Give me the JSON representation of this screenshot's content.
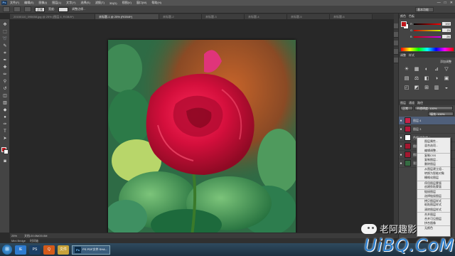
{
  "menubar": {
    "logo": "Ps",
    "items": [
      "文件(F)",
      "编辑(E)",
      "图像(I)",
      "图层(L)",
      "文字(Y)",
      "选择(S)",
      "滤镜(T)",
      "3D(D)",
      "视图(V)",
      "窗口(W)",
      "帮助(H)"
    ],
    "controls": [
      "—",
      "□",
      "✕"
    ]
  },
  "optionsbar": {
    "mode_label": "正常",
    "width_label": "宽度:",
    "adjust_label": "调整边缘...",
    "workspace": "基本功能"
  },
  "tabs": [
    {
      "label": "20150110_095658.jpg @ 25% (图层 4, RGB/8*)",
      "active": false
    },
    {
      "label": "未标题-1 @ 25% (RGB/8*)",
      "active": true
    },
    {
      "label": "未标题-2",
      "active": false
    },
    {
      "label": "未标题-3",
      "active": false
    },
    {
      "label": "未标题-4",
      "active": false
    },
    {
      "label": "未标题-5",
      "active": false
    },
    {
      "label": "未标题-6",
      "active": false
    }
  ],
  "statusbar": {
    "zoom": "25%",
    "doc_info": "文档:20.0M/20.0M"
  },
  "minibridge": [
    "Mini Bridge",
    "时间轴"
  ],
  "panels": {
    "tabs": [
      "颜色",
      "色板"
    ],
    "sliders": [
      {
        "label": "R",
        "value": "192"
      },
      {
        "label": "G",
        "value": "21"
      },
      {
        "label": "B",
        "value": "26"
      }
    ],
    "adjust_tabs": [
      "调整",
      "样式"
    ],
    "adjust_title": "添加调整",
    "adj_icons": [
      "☀",
      "▦",
      "◐",
      "⊿",
      "▽",
      "▤",
      "⚖",
      "◧",
      "◑",
      "▣",
      "◰",
      "◩",
      "⊞",
      "▥",
      "◒"
    ],
    "layers_tabs": [
      "图层",
      "通道",
      "路径"
    ],
    "blend_mode": "正常",
    "opacity": "不透明度: 100%",
    "fill": "填充: 100%",
    "layers": [
      {
        "name": "图层 4",
        "selected": true
      },
      {
        "name": "图层 3",
        "selected": false
      },
      {
        "name": "色相/饱和度 1",
        "selected": false
      },
      {
        "name": "图层 2",
        "selected": false
      },
      {
        "name": "图层 1",
        "selected": false
      },
      {
        "name": "背景",
        "selected": false
      }
    ]
  },
  "context_menu": {
    "items": [
      "图层属性...",
      "混合选项...",
      "编辑调整...",
      "复制CSS",
      "复制图层...",
      "删除图层",
      "从图层建立组...",
      "转换为智能对象",
      "栅格化图层",
      "停用图层蒙版",
      "创建剪贴蒙版",
      "链接图层",
      "选择链接图层",
      "拷贝图层样式",
      "粘贴图层样式",
      "清除图层样式",
      "合并图层",
      "合并可见图层",
      "拼合图像",
      "无颜色"
    ]
  },
  "taskbar": {
    "apps": [
      "IE",
      "PS",
      "Q",
      "文件"
    ],
    "ps_label": "PS PDF文件 SHA..."
  },
  "watermark": {
    "name": "老阿趣影",
    "site": "UiBQ.CoM"
  },
  "colors": {
    "foreground": "#c0151a",
    "background": "#ffffff",
    "panel": "#444444",
    "selected_layer": "#4f5f7a"
  }
}
